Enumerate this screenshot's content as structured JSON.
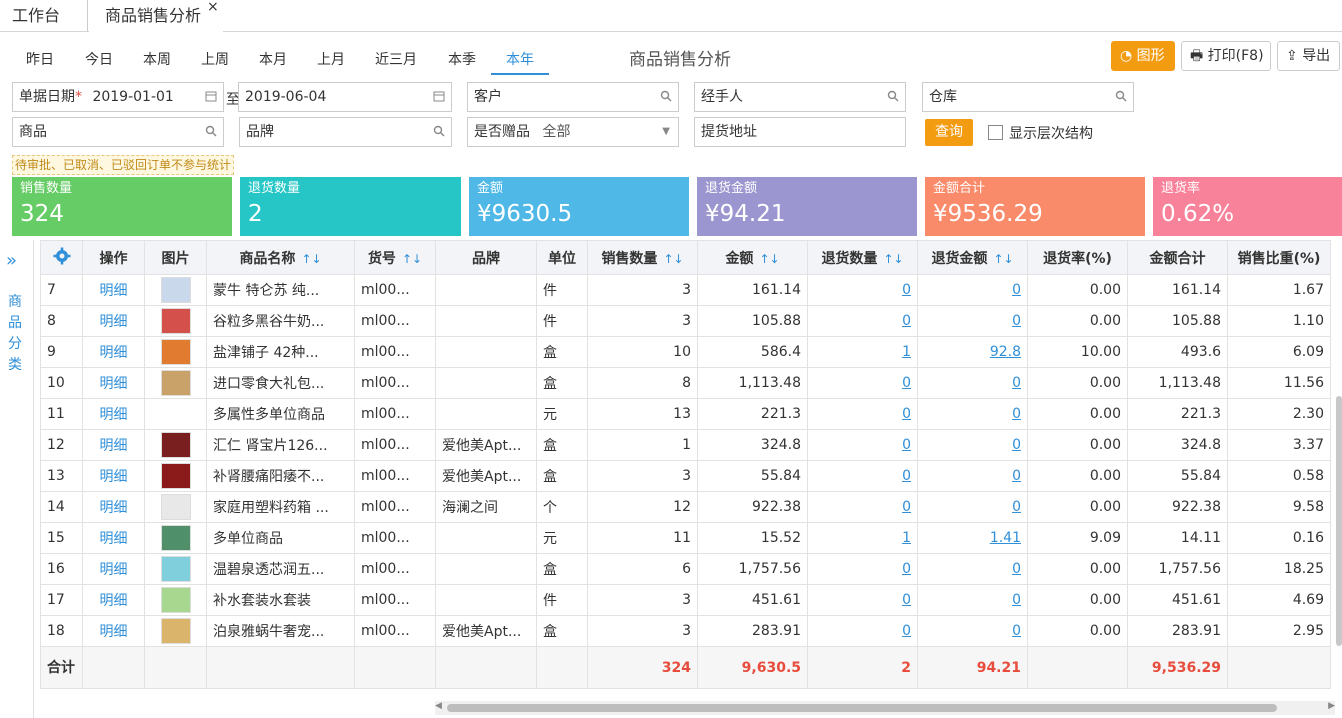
{
  "tabs": {
    "workbench": "工作台",
    "current": "商品销售分析",
    "close": "×"
  },
  "periods": [
    "昨日",
    "今日",
    "本周",
    "上周",
    "本月",
    "上月",
    "近三月",
    "本季",
    "本年"
  ],
  "active_period": "本年",
  "page_title": "商品销售分析",
  "toolbar": {
    "chart": "图形",
    "print": "打印(F8)",
    "export": "导出"
  },
  "filters": {
    "date_label": "单据日期",
    "required_mark": "*",
    "date_from": "2019-01-01",
    "to_label": "至",
    "date_to": "2019-06-04",
    "customer": "客户",
    "handler": "经手人",
    "warehouse": "仓库",
    "product": "商品",
    "brand": "品牌",
    "gift_label": "是否赠品",
    "gift_value": "全部",
    "address": "提货地址",
    "query": "查询",
    "show_hierarchy": "显示层次结构"
  },
  "note": "待审批、已取消、已驳回订单不参与统计",
  "cards": [
    {
      "label": "销售数量",
      "value": "324",
      "color": "#66cc66"
    },
    {
      "label": "退货数量",
      "value": "2",
      "color": "#26c6c6"
    },
    {
      "label": "金额",
      "value": "¥9630.5",
      "color": "#4fb8e6"
    },
    {
      "label": "退货金额",
      "value": "¥94.21",
      "color": "#9b96cf"
    },
    {
      "label": "金额合计",
      "value": "¥9536.29",
      "color": "#f98b6b"
    },
    {
      "label": "退货率",
      "value": "0.62%",
      "color": "#f9829b"
    }
  ],
  "sidebar": {
    "chevron": "»",
    "label": "商品分类"
  },
  "table": {
    "columns": [
      "操作",
      "图片",
      "商品名称",
      "货号",
      "品牌",
      "单位",
      "销售数量",
      "金额",
      "退货数量",
      "退货金额",
      "退货率(%)",
      "金额合计",
      "销售比重(%)"
    ],
    "sort_icon": "↑↓",
    "rows": [
      {
        "no": "7",
        "op": "明细",
        "name": "蒙牛 特仑苏 纯...",
        "sku": "ml00...",
        "brand": "",
        "unit": "件",
        "qty": "3",
        "amount": "161.14",
        "rqty": "0",
        "ramount": "0",
        "rrate": "0.00",
        "total": "161.14",
        "share": "1.67",
        "img": "#c9d8ea"
      },
      {
        "no": "8",
        "op": "明细",
        "name": "谷粒多黑谷牛奶...",
        "sku": "ml00...",
        "brand": "",
        "unit": "件",
        "qty": "3",
        "amount": "105.88",
        "rqty": "0",
        "ramount": "0",
        "rrate": "0.00",
        "total": "105.88",
        "share": "1.10",
        "img": "#d4504a"
      },
      {
        "no": "9",
        "op": "明细",
        "name": "盐津铺子 42种...",
        "sku": "ml00...",
        "brand": "",
        "unit": "盒",
        "qty": "10",
        "amount": "586.4",
        "rqty": "1",
        "ramount": "92.8",
        "rrate": "10.00",
        "total": "493.6",
        "share": "6.09",
        "img": "#e07b2f"
      },
      {
        "no": "10",
        "op": "明细",
        "name": "进口零食大礼包...",
        "sku": "ml00...",
        "brand": "",
        "unit": "盒",
        "qty": "8",
        "amount": "1,113.48",
        "rqty": "0",
        "ramount": "0",
        "rrate": "0.00",
        "total": "1,113.48",
        "share": "11.56",
        "img": "#c9a26a"
      },
      {
        "no": "11",
        "op": "明细",
        "name": "多属性多单位商品",
        "sku": "ml00...",
        "brand": "",
        "unit": "元",
        "qty": "13",
        "amount": "221.3",
        "rqty": "0",
        "ramount": "0",
        "rrate": "0.00",
        "total": "221.3",
        "share": "2.30",
        "img": ""
      },
      {
        "no": "12",
        "op": "明细",
        "name": "汇仁 肾宝片126...",
        "sku": "ml00...",
        "brand": "爱他美Apt...",
        "unit": "盒",
        "qty": "1",
        "amount": "324.8",
        "rqty": "0",
        "ramount": "0",
        "rrate": "0.00",
        "total": "324.8",
        "share": "3.37",
        "img": "#7a1f1f"
      },
      {
        "no": "13",
        "op": "明细",
        "name": "补肾腰痛阳痿不...",
        "sku": "ml00...",
        "brand": "爱他美Apt...",
        "unit": "盒",
        "qty": "3",
        "amount": "55.84",
        "rqty": "0",
        "ramount": "0",
        "rrate": "0.00",
        "total": "55.84",
        "share": "0.58",
        "img": "#8b1a1a"
      },
      {
        "no": "14",
        "op": "明细",
        "name": "家庭用塑料药箱 ...",
        "sku": "ml00...",
        "brand": "海澜之间",
        "unit": "个",
        "qty": "12",
        "amount": "922.38",
        "rqty": "0",
        "ramount": "0",
        "rrate": "0.00",
        "total": "922.38",
        "share": "9.58",
        "img": "#e8e8e8"
      },
      {
        "no": "15",
        "op": "明细",
        "name": "多单位商品",
        "sku": "ml00...",
        "brand": "",
        "unit": "元",
        "qty": "11",
        "amount": "15.52",
        "rqty": "1",
        "ramount": "1.41",
        "rrate": "9.09",
        "total": "14.11",
        "share": "0.16",
        "img": "#4f8f6a"
      },
      {
        "no": "16",
        "op": "明细",
        "name": "温碧泉透芯润五...",
        "sku": "ml00...",
        "brand": "",
        "unit": "盒",
        "qty": "6",
        "amount": "1,757.56",
        "rqty": "0",
        "ramount": "0",
        "rrate": "0.00",
        "total": "1,757.56",
        "share": "18.25",
        "img": "#7fd0dc"
      },
      {
        "no": "17",
        "op": "明细",
        "name": "补水套装水套装",
        "sku": "ml00...",
        "brand": "",
        "unit": "件",
        "qty": "3",
        "amount": "451.61",
        "rqty": "0",
        "ramount": "0",
        "rrate": "0.00",
        "total": "451.61",
        "share": "4.69",
        "img": "#a8d890"
      },
      {
        "no": "18",
        "op": "明细",
        "name": "泊泉雅蜗牛奢宠...",
        "sku": "ml00...",
        "brand": "爱他美Apt...",
        "unit": "盒",
        "qty": "3",
        "amount": "283.91",
        "rqty": "0",
        "ramount": "0",
        "rrate": "0.00",
        "total": "283.91",
        "share": "2.95",
        "img": "#d9b46a"
      }
    ],
    "footer": {
      "label": "合计",
      "qty": "324",
      "amount": "9,630.5",
      "rqty": "2",
      "ramount": "94.21",
      "total": "9,536.29"
    }
  }
}
